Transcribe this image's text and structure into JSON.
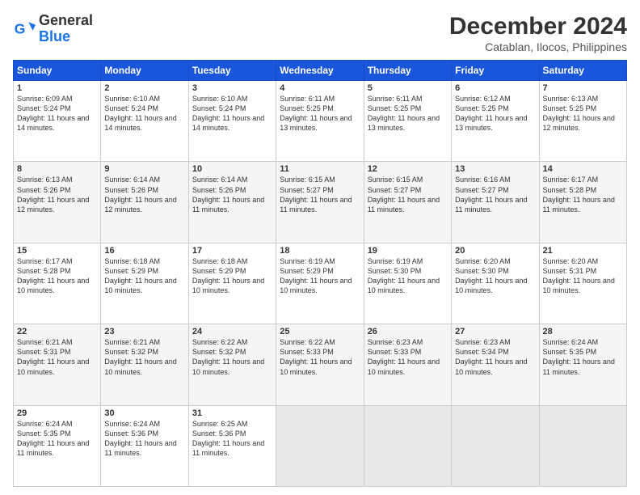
{
  "logo": {
    "line1": "General",
    "line2": "Blue"
  },
  "title": "December 2024",
  "subtitle": "Catablan, Ilocos, Philippines",
  "days_of_week": [
    "Sunday",
    "Monday",
    "Tuesday",
    "Wednesday",
    "Thursday",
    "Friday",
    "Saturday"
  ],
  "weeks": [
    [
      {
        "num": "1",
        "sunrise": "6:09 AM",
        "sunset": "5:24 PM",
        "daylight": "11 hours and 14 minutes."
      },
      {
        "num": "2",
        "sunrise": "6:10 AM",
        "sunset": "5:24 PM",
        "daylight": "11 hours and 14 minutes."
      },
      {
        "num": "3",
        "sunrise": "6:10 AM",
        "sunset": "5:24 PM",
        "daylight": "11 hours and 14 minutes."
      },
      {
        "num": "4",
        "sunrise": "6:11 AM",
        "sunset": "5:25 PM",
        "daylight": "11 hours and 13 minutes."
      },
      {
        "num": "5",
        "sunrise": "6:11 AM",
        "sunset": "5:25 PM",
        "daylight": "11 hours and 13 minutes."
      },
      {
        "num": "6",
        "sunrise": "6:12 AM",
        "sunset": "5:25 PM",
        "daylight": "11 hours and 13 minutes."
      },
      {
        "num": "7",
        "sunrise": "6:13 AM",
        "sunset": "5:25 PM",
        "daylight": "11 hours and 12 minutes."
      }
    ],
    [
      {
        "num": "8",
        "sunrise": "6:13 AM",
        "sunset": "5:26 PM",
        "daylight": "11 hours and 12 minutes."
      },
      {
        "num": "9",
        "sunrise": "6:14 AM",
        "sunset": "5:26 PM",
        "daylight": "11 hours and 12 minutes."
      },
      {
        "num": "10",
        "sunrise": "6:14 AM",
        "sunset": "5:26 PM",
        "daylight": "11 hours and 11 minutes."
      },
      {
        "num": "11",
        "sunrise": "6:15 AM",
        "sunset": "5:27 PM",
        "daylight": "11 hours and 11 minutes."
      },
      {
        "num": "12",
        "sunrise": "6:15 AM",
        "sunset": "5:27 PM",
        "daylight": "11 hours and 11 minutes."
      },
      {
        "num": "13",
        "sunrise": "6:16 AM",
        "sunset": "5:27 PM",
        "daylight": "11 hours and 11 minutes."
      },
      {
        "num": "14",
        "sunrise": "6:17 AM",
        "sunset": "5:28 PM",
        "daylight": "11 hours and 11 minutes."
      }
    ],
    [
      {
        "num": "15",
        "sunrise": "6:17 AM",
        "sunset": "5:28 PM",
        "daylight": "11 hours and 10 minutes."
      },
      {
        "num": "16",
        "sunrise": "6:18 AM",
        "sunset": "5:29 PM",
        "daylight": "11 hours and 10 minutes."
      },
      {
        "num": "17",
        "sunrise": "6:18 AM",
        "sunset": "5:29 PM",
        "daylight": "11 hours and 10 minutes."
      },
      {
        "num": "18",
        "sunrise": "6:19 AM",
        "sunset": "5:29 PM",
        "daylight": "11 hours and 10 minutes."
      },
      {
        "num": "19",
        "sunrise": "6:19 AM",
        "sunset": "5:30 PM",
        "daylight": "11 hours and 10 minutes."
      },
      {
        "num": "20",
        "sunrise": "6:20 AM",
        "sunset": "5:30 PM",
        "daylight": "11 hours and 10 minutes."
      },
      {
        "num": "21",
        "sunrise": "6:20 AM",
        "sunset": "5:31 PM",
        "daylight": "11 hours and 10 minutes."
      }
    ],
    [
      {
        "num": "22",
        "sunrise": "6:21 AM",
        "sunset": "5:31 PM",
        "daylight": "11 hours and 10 minutes."
      },
      {
        "num": "23",
        "sunrise": "6:21 AM",
        "sunset": "5:32 PM",
        "daylight": "11 hours and 10 minutes."
      },
      {
        "num": "24",
        "sunrise": "6:22 AM",
        "sunset": "5:32 PM",
        "daylight": "11 hours and 10 minutes."
      },
      {
        "num": "25",
        "sunrise": "6:22 AM",
        "sunset": "5:33 PM",
        "daylight": "11 hours and 10 minutes."
      },
      {
        "num": "26",
        "sunrise": "6:23 AM",
        "sunset": "5:33 PM",
        "daylight": "11 hours and 10 minutes."
      },
      {
        "num": "27",
        "sunrise": "6:23 AM",
        "sunset": "5:34 PM",
        "daylight": "11 hours and 10 minutes."
      },
      {
        "num": "28",
        "sunrise": "6:24 AM",
        "sunset": "5:35 PM",
        "daylight": "11 hours and 11 minutes."
      }
    ],
    [
      {
        "num": "29",
        "sunrise": "6:24 AM",
        "sunset": "5:35 PM",
        "daylight": "11 hours and 11 minutes."
      },
      {
        "num": "30",
        "sunrise": "6:24 AM",
        "sunset": "5:36 PM",
        "daylight": "11 hours and 11 minutes."
      },
      {
        "num": "31",
        "sunrise": "6:25 AM",
        "sunset": "5:36 PM",
        "daylight": "11 hours and 11 minutes."
      },
      null,
      null,
      null,
      null
    ]
  ]
}
